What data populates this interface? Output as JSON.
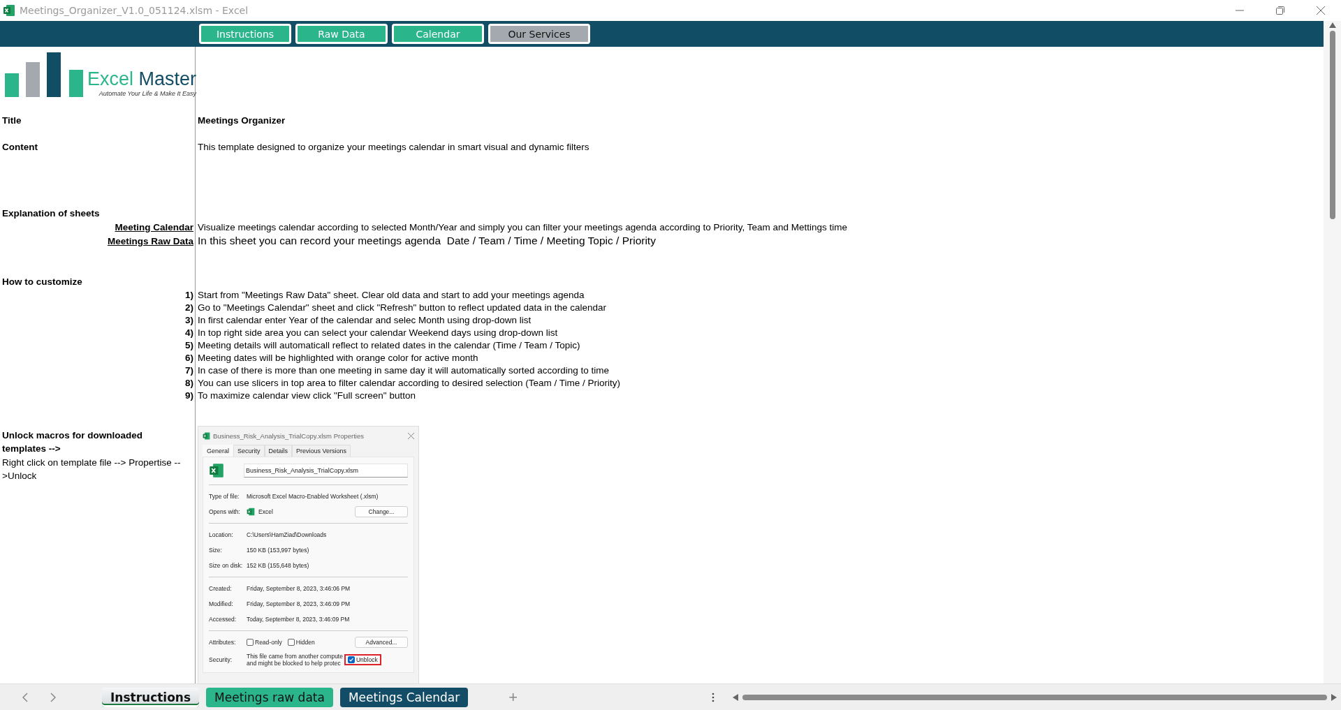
{
  "window": {
    "title": "Meetings_Organizer_V1.0_051124.xlsm - Excel"
  },
  "nav_buttons": [
    {
      "label": "Instructions",
      "color": "#2bb58a"
    },
    {
      "label": "Raw Data",
      "color": "#2bb58a"
    },
    {
      "label": "Calendar",
      "color": "#2bb58a"
    },
    {
      "label": "Our Services",
      "color": "#a3a9ae"
    }
  ],
  "logo": {
    "name_part1": "Excel",
    "name_part2": "Master",
    "tagline": "Automate Your Life & Make It Easy"
  },
  "title": {
    "label": "Title",
    "value": "Meetings Organizer"
  },
  "content": {
    "label": "Content",
    "value": "This template designed to organize your meetings calendar in smart visual and dynamic filters"
  },
  "explanation": {
    "heading": "Explanation of sheets",
    "sheets": [
      {
        "name": "Meeting Calendar",
        "description": "Visualize meetings calendar according to selected Month/Year and simply you can filter your meetings agenda according to Priority, Team and Mettings time",
        "kind": "normal"
      },
      {
        "name": "Meetings Raw Data",
        "description": "In this sheet you can record your meetings agenda  Date / Team / Time / Meeting Topic / Priority",
        "kind": "large"
      }
    ]
  },
  "customize": {
    "heading": "How to customize",
    "steps": [
      {
        "number": "1)",
        "text": "Start from \"Meetings Raw Data\" sheet. Clear old data and start to add your meetings agenda"
      },
      {
        "number": "2)",
        "text": "Go to \"Meetings Calendar\" sheet and click \"Refresh\" button to reflect updated data in the calendar"
      },
      {
        "number": "3)",
        "text": "In first calendar enter Year of the calendar and selec Month using drop-down list"
      },
      {
        "number": "4)",
        "text": "In top right side area you can select your calendar Weekend days using drop-down list"
      },
      {
        "number": "5)",
        "text": "Meeting details will automaticall reflect to related dates in the calendar (Time / Team / Topic)"
      },
      {
        "number": "6)",
        "text": "Meeting dates will be highlighted with orange color for active month"
      },
      {
        "number": "7)",
        "text": "In case of there is more than one meeting in same day it will automatically sorted according to time"
      },
      {
        "number": "8)",
        "text": "You can use slicers in top area to filter calendar according to desired selection (Team / Time / Priority)"
      },
      {
        "number": "9)",
        "text": "To maximize calendar view click \"Full screen\" button"
      }
    ]
  },
  "unlock": {
    "heading": "Unlock macros for downloaded templates -->",
    "instruction": "Right click on template file --> Propertise -->Unlock"
  },
  "properties_dialog": {
    "title": "Business_Risk_Analysis_TrialCopy.xlsm Properties",
    "tabs": [
      {
        "label": "General",
        "selected": true
      },
      {
        "label": "Security",
        "selected": false
      },
      {
        "label": "Details",
        "selected": false
      },
      {
        "label": "Previous Versions",
        "selected": false
      }
    ],
    "file_name": "Business_Risk_Analysis_TrialCopy.xlsm",
    "groups": [
      [
        {
          "label": "Type of file:",
          "value": "Microsoft Excel Macro-Enabled Worksheet (.xlsm)",
          "kind": "text"
        },
        {
          "label": "Opens with:",
          "value": "Excel",
          "kind": "app",
          "button": "Change..."
        }
      ],
      [
        {
          "label": "Location:",
          "value": "C:\\Users\\HamZiad\\Downloads",
          "kind": "text"
        },
        {
          "label": "Size:",
          "value": "150 KB (153,997 bytes)",
          "kind": "text"
        },
        {
          "label": "Size on disk:",
          "value": "152 KB (155,648 bytes)",
          "kind": "text"
        }
      ],
      [
        {
          "label": "Created:",
          "value": "Friday, September 8, 2023, 3:46:06 PM",
          "kind": "text"
        },
        {
          "label": "Modified:",
          "value": "Friday, September 8, 2023, 3:46:09 PM",
          "kind": "text"
        },
        {
          "label": "Accessed:",
          "value": "Today, September 8, 2023, 3:46:09 PM",
          "kind": "text"
        }
      ]
    ],
    "attributes": {
      "label": "Attributes:",
      "options": [
        {
          "label": "Read-only",
          "checked": false
        },
        {
          "label": "Hidden",
          "checked": false
        }
      ],
      "button": "Advanced..."
    },
    "security": {
      "label": "Security:",
      "lines": [
        "This file came from another compute",
        "and might be blocked to help protec"
      ],
      "unblock": {
        "label": "Unblock",
        "checked": true
      }
    }
  },
  "sheet_tabs": [
    {
      "label": "Instructions",
      "selected": true,
      "color": "#d5dade"
    },
    {
      "label": "Meetings raw data",
      "selected": false,
      "color": "#2bb58a"
    },
    {
      "label": "Meetings Calendar",
      "selected": false,
      "color": "#134c66"
    }
  ],
  "add_sheet": "+"
}
